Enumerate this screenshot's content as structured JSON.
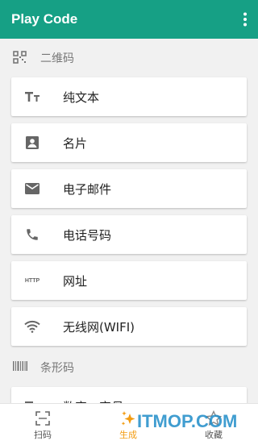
{
  "app_title": "Play Code",
  "sections": {
    "qrcode": {
      "label": "二维码"
    },
    "barcode": {
      "label": "条形码"
    }
  },
  "qr_items": [
    {
      "label": "纯文本",
      "icon": "text-icon"
    },
    {
      "label": "名片",
      "icon": "contact-card-icon"
    },
    {
      "label": "电子邮件",
      "icon": "email-icon"
    },
    {
      "label": "电话号码",
      "icon": "phone-icon"
    },
    {
      "label": "网址",
      "icon": "http-icon",
      "icon_text": "HTTP"
    },
    {
      "label": "无线网(WIFI)",
      "icon": "wifi-icon"
    }
  ],
  "barcode_items": [
    {
      "label": "数字、字母",
      "icon": "text-icon"
    }
  ],
  "bottom_nav": {
    "scan": "扫码",
    "generate": "生成",
    "favorites": "收藏"
  },
  "watermark": "ITMOP.COM",
  "colors": {
    "appbar": "#16a085",
    "active_tab": "#f39c12",
    "watermark": "#1e8cc8"
  }
}
